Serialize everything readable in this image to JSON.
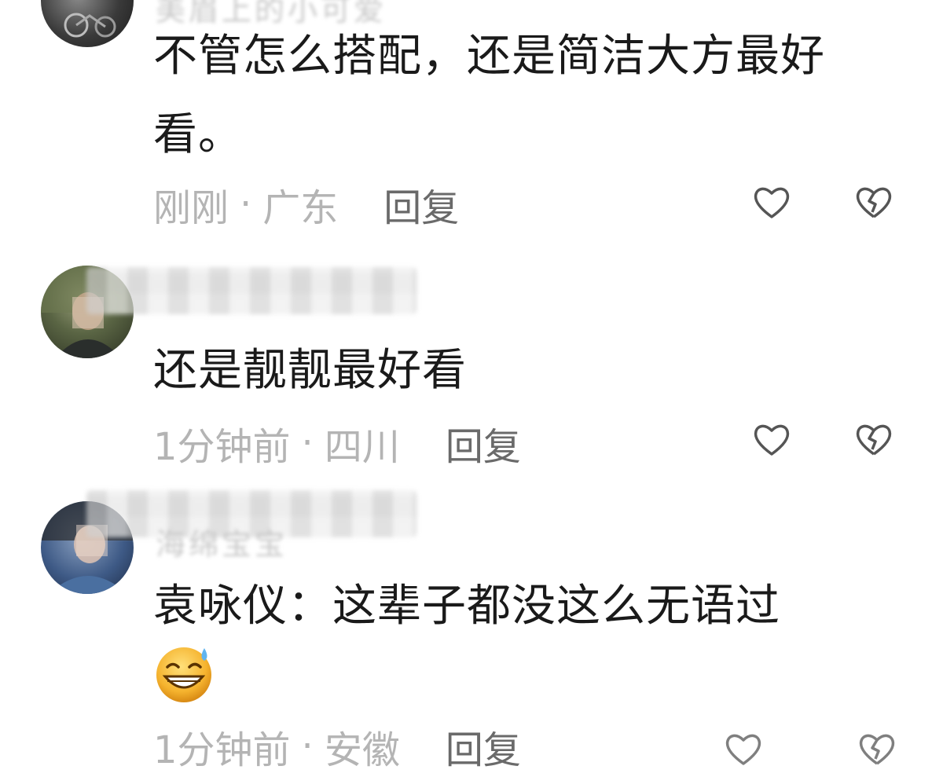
{
  "comments": [
    {
      "username": "美眉上的小可爱",
      "text": "不管怎么搭配，还是简洁大方最好看。",
      "time": "刚刚",
      "location": "广东",
      "reply_label": "回复",
      "avatar_colors": [
        "#2a2a2a",
        "#6b6b6b"
      ]
    },
    {
      "username": "",
      "text": "还是靓靓最好看",
      "time": "1分钟前",
      "location": "四川",
      "reply_label": "回复",
      "avatar_colors": [
        "#4c5a3c",
        "#2e3526"
      ]
    },
    {
      "username": "海绵宝宝",
      "text": "袁咏仪：这辈子都没这么无语过",
      "time": "1分钟前",
      "location": "安徽",
      "reply_label": "回复",
      "avatar_colors": [
        "#3a5a8a",
        "#1f2f4a"
      ]
    }
  ],
  "separator": "·",
  "icons": {
    "like": "heart-outline-icon",
    "dislike": "broken-heart-icon",
    "emoji": "grinning-sweat-emoji"
  },
  "colors": {
    "text": "#1a1a1a",
    "meta": "#b4b4b4",
    "reply": "#6a6a6a",
    "icon": "#555555"
  }
}
